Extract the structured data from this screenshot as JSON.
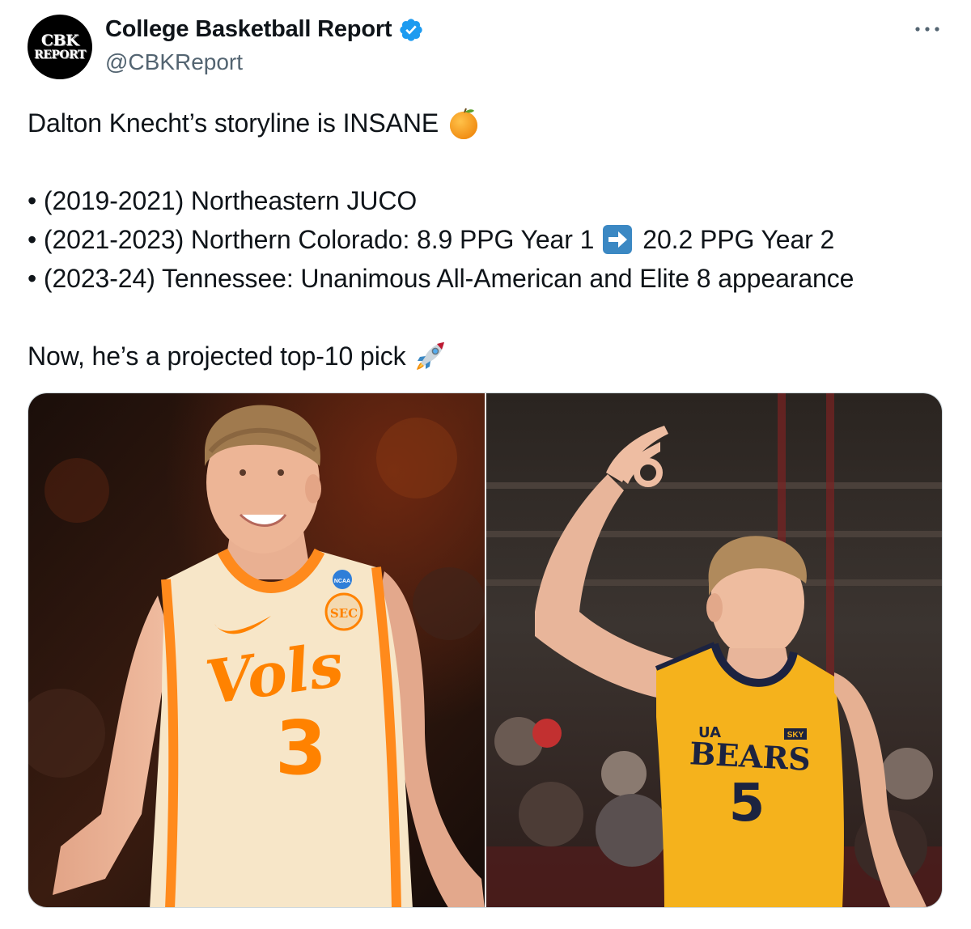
{
  "author": {
    "avatar_line1": "CBK",
    "avatar_line2": "REPORT",
    "display_name": "College Basketball Report",
    "handle": "@CBKReport",
    "verified_color": "#1d9bf0"
  },
  "tweet": {
    "line1": "Dalton Knecht’s storyline is INSANE",
    "line1_emoji": "orange-icon",
    "bullets": [
      "• (2019-2021) Northeastern JUCO",
      "• (2021-2023) Northern Colorado: 8.9 PPG Year 1",
      "• (2023-24) Tennessee: Unanimous All-American and Elite 8 appearance"
    ],
    "bullet2_after_arrow": "20.2 PPG Year 2",
    "arrow_emoji": "right-arrow-icon",
    "closing": "Now, he’s a projected top-10 pick",
    "closing_emoji": "rocket-icon"
  },
  "media": {
    "left_photo": {
      "jersey_script": "Vols",
      "jersey_number": "3",
      "patch_top": "NCAA",
      "patch_bottom": "SEC"
    },
    "right_photo": {
      "jersey_text": "BEARS",
      "jersey_number": "5",
      "sponsor": "SKY",
      "brand": "UA"
    }
  },
  "colors": {
    "vols_orange": "#ff8200",
    "bears_gold": "#f7b21b",
    "text": "#0f1419",
    "secondary": "#536471"
  }
}
